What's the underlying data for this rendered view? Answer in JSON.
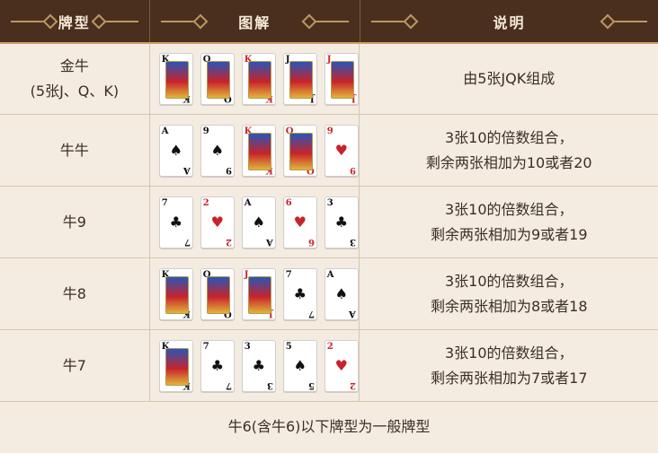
{
  "header": {
    "col1": "牌型",
    "col2": "图解",
    "col3": "说明"
  },
  "rows": [
    {
      "type_line1": "金牛",
      "type_line2": "(5张J、Q、K)",
      "desc_line1": "由5张JQK组成",
      "desc_line2": "",
      "cards": [
        {
          "rank": "K",
          "suit": "♠",
          "color": "black",
          "face": true
        },
        {
          "rank": "Q",
          "suit": "♣",
          "color": "black",
          "face": true
        },
        {
          "rank": "K",
          "suit": "♦",
          "color": "red",
          "face": true
        },
        {
          "rank": "J",
          "suit": "♣",
          "color": "black",
          "face": true
        },
        {
          "rank": "J",
          "suit": "♦",
          "color": "red",
          "face": true
        }
      ]
    },
    {
      "type_line1": "牛牛",
      "type_line2": "",
      "desc_line1": "3张10的倍数组合，",
      "desc_line2": "剩余两张相加为10或者20",
      "cards": [
        {
          "rank": "A",
          "suit": "♠",
          "color": "black",
          "face": false
        },
        {
          "rank": "9",
          "suit": "♠",
          "color": "black",
          "face": false
        },
        {
          "rank": "K",
          "suit": "♦",
          "color": "red",
          "face": true
        },
        {
          "rank": "Q",
          "suit": "♦",
          "color": "red",
          "face": true
        },
        {
          "rank": "9",
          "suit": "♥",
          "color": "red",
          "face": false
        }
      ]
    },
    {
      "type_line1": "牛9",
      "type_line2": "",
      "desc_line1": "3张10的倍数组合，",
      "desc_line2": "剩余两张相加为9或者19",
      "cards": [
        {
          "rank": "7",
          "suit": "♣",
          "color": "black",
          "face": false
        },
        {
          "rank": "2",
          "suit": "♥",
          "color": "red",
          "face": false
        },
        {
          "rank": "A",
          "suit": "♠",
          "color": "black",
          "face": false
        },
        {
          "rank": "6",
          "suit": "♥",
          "color": "red",
          "face": false
        },
        {
          "rank": "3",
          "suit": "♣",
          "color": "black",
          "face": false
        }
      ]
    },
    {
      "type_line1": "牛8",
      "type_line2": "",
      "desc_line1": "3张10的倍数组合，",
      "desc_line2": "剩余两张相加为8或者18",
      "cards": [
        {
          "rank": "K",
          "suit": "♠",
          "color": "black",
          "face": true
        },
        {
          "rank": "Q",
          "suit": "♣",
          "color": "black",
          "face": true
        },
        {
          "rank": "J",
          "suit": "♦",
          "color": "red",
          "face": true
        },
        {
          "rank": "7",
          "suit": "♣",
          "color": "black",
          "face": false
        },
        {
          "rank": "A",
          "suit": "♠",
          "color": "black",
          "face": false
        }
      ]
    },
    {
      "type_line1": "牛7",
      "type_line2": "",
      "desc_line1": "3张10的倍数组合，",
      "desc_line2": "剩余两张相加为7或者17",
      "cards": [
        {
          "rank": "K",
          "suit": "♠",
          "color": "black",
          "face": true
        },
        {
          "rank": "7",
          "suit": "♣",
          "color": "black",
          "face": false
        },
        {
          "rank": "3",
          "suit": "♣",
          "color": "black",
          "face": false
        },
        {
          "rank": "5",
          "suit": "♠",
          "color": "black",
          "face": false
        },
        {
          "rank": "2",
          "suit": "♥",
          "color": "red",
          "face": false
        }
      ]
    }
  ],
  "footer": {
    "text": "牛6(含牛6)以下牌型为一般牌型"
  },
  "colors": {
    "header_bg": "#4a2f1e",
    "accent_gold": "#caa36b",
    "table_bg": "#f4ece1",
    "grid": "#d7c7b0",
    "red_suit": "#c8232b"
  }
}
